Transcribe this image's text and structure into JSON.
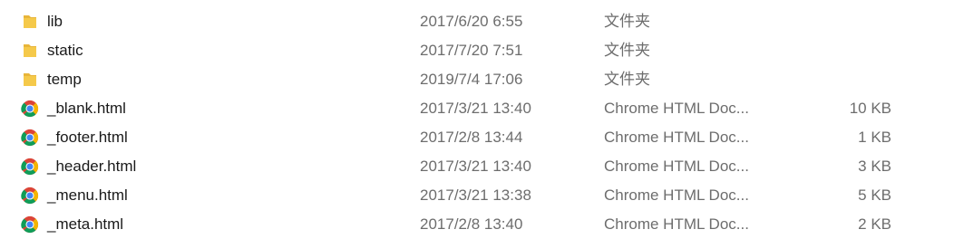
{
  "files": [
    {
      "name": "lib",
      "modified": "2017/6/20 6:55",
      "type": "文件夹",
      "size": "",
      "icon": "folder-icon"
    },
    {
      "name": "static",
      "modified": "2017/7/20 7:51",
      "type": "文件夹",
      "size": "",
      "icon": "folder-icon"
    },
    {
      "name": "temp",
      "modified": "2019/7/4 17:06",
      "type": "文件夹",
      "size": "",
      "icon": "folder-icon"
    },
    {
      "name": "_blank.html",
      "modified": "2017/3/21 13:40",
      "type": "Chrome HTML Doc...",
      "size": "10 KB",
      "icon": "chrome-icon"
    },
    {
      "name": "_footer.html",
      "modified": "2017/2/8 13:44",
      "type": "Chrome HTML Doc...",
      "size": "1 KB",
      "icon": "chrome-icon"
    },
    {
      "name": "_header.html",
      "modified": "2017/3/21 13:40",
      "type": "Chrome HTML Doc...",
      "size": "3 KB",
      "icon": "chrome-icon"
    },
    {
      "name": "_menu.html",
      "modified": "2017/3/21 13:38",
      "type": "Chrome HTML Doc...",
      "size": "5 KB",
      "icon": "chrome-icon"
    },
    {
      "name": "_meta.html",
      "modified": "2017/2/8 13:40",
      "type": "Chrome HTML Doc...",
      "size": "2 KB",
      "icon": "chrome-icon"
    }
  ],
  "colors": {
    "folder": "#f5c94a",
    "chrome_red": "#db4437",
    "chrome_yellow": "#f4b400",
    "chrome_green": "#0f9d58",
    "chrome_blue": "#4285f4"
  }
}
